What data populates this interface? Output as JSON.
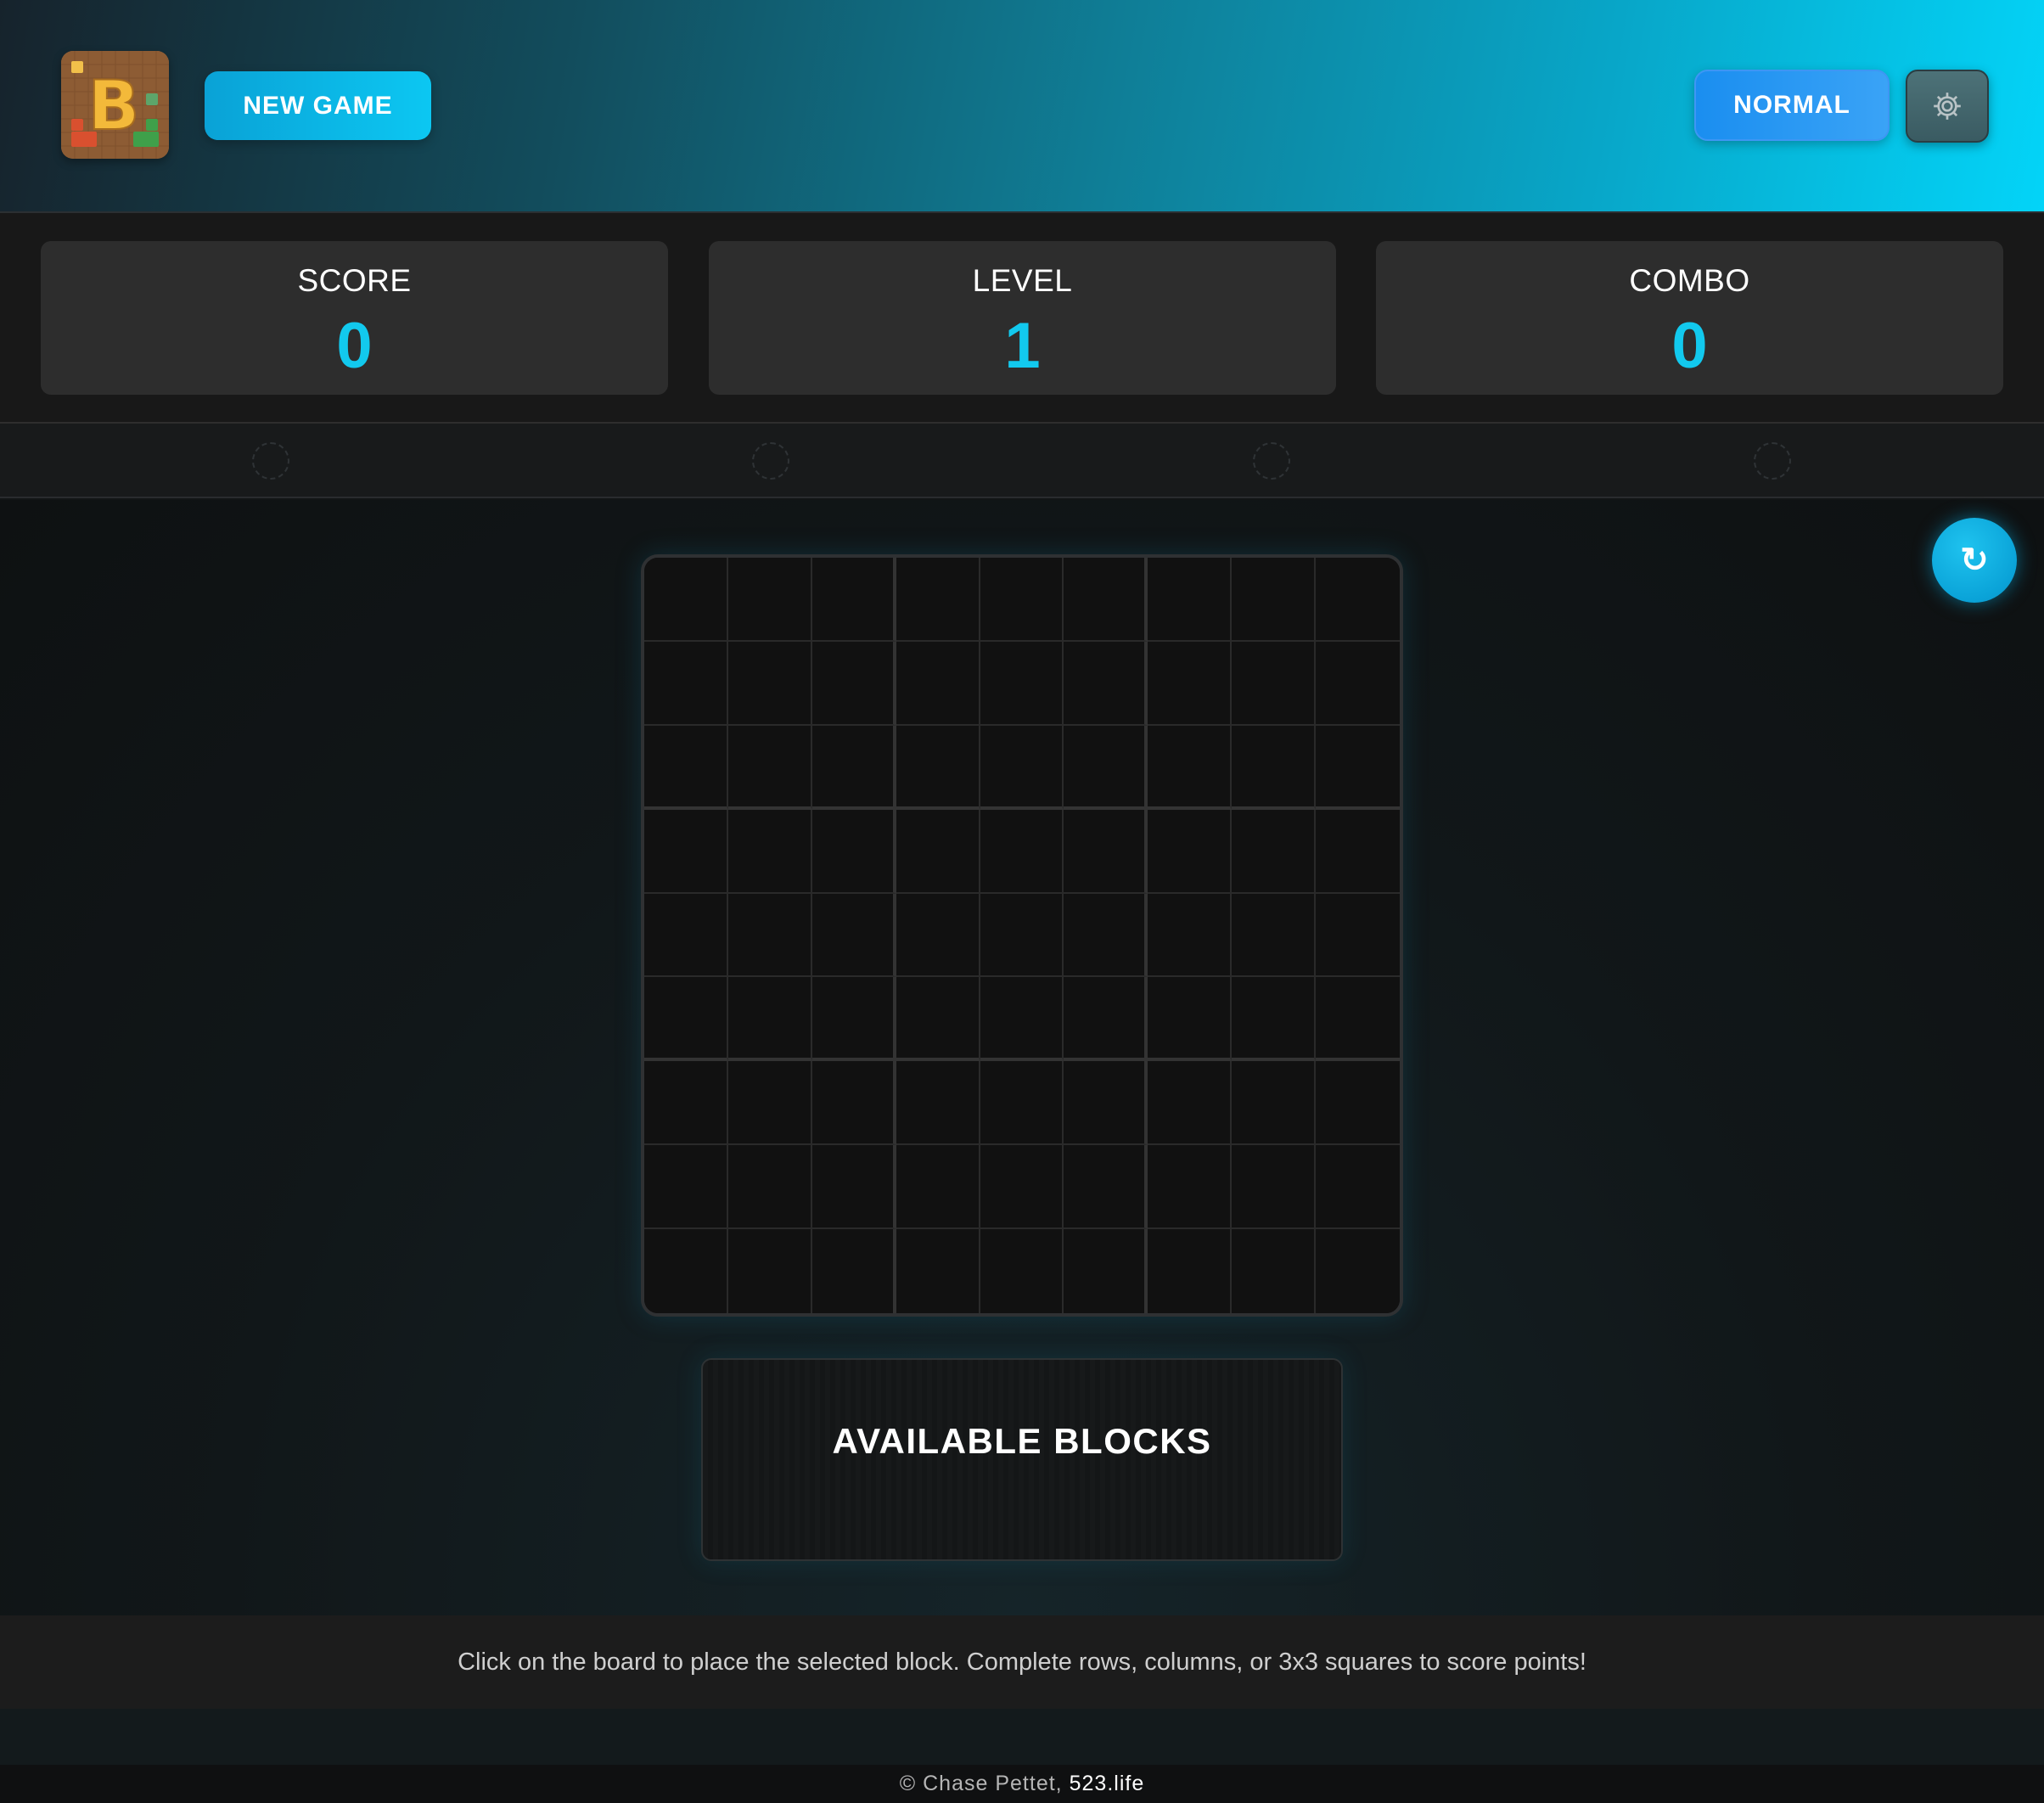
{
  "header": {
    "logo_letter": "B",
    "new_game_label": "NEW GAME",
    "difficulty_label": "NORMAL",
    "settings_icon": "gear-icon",
    "gradient_colors": [
      "#16232c",
      "#03d4f8"
    ]
  },
  "stats": [
    {
      "label": "SCORE",
      "value": "0"
    },
    {
      "label": "LEVEL",
      "value": "1"
    },
    {
      "label": "COMBO",
      "value": "0"
    }
  ],
  "indicators_count": 4,
  "restart_icon": "↻",
  "board": {
    "rows": 9,
    "cols": 9,
    "empty_cells": 81
  },
  "blocks_panel": {
    "title": "AVAILABLE BLOCKS"
  },
  "instructions": "Click on the board to place the selected block. Complete rows, columns, or 3x3 squares to score points!",
  "footer": {
    "copyright": "© Chase Pettet,",
    "site": "523.life"
  },
  "colors": {
    "accent": "#12c9ee",
    "difficulty": "#1a8ef0"
  }
}
